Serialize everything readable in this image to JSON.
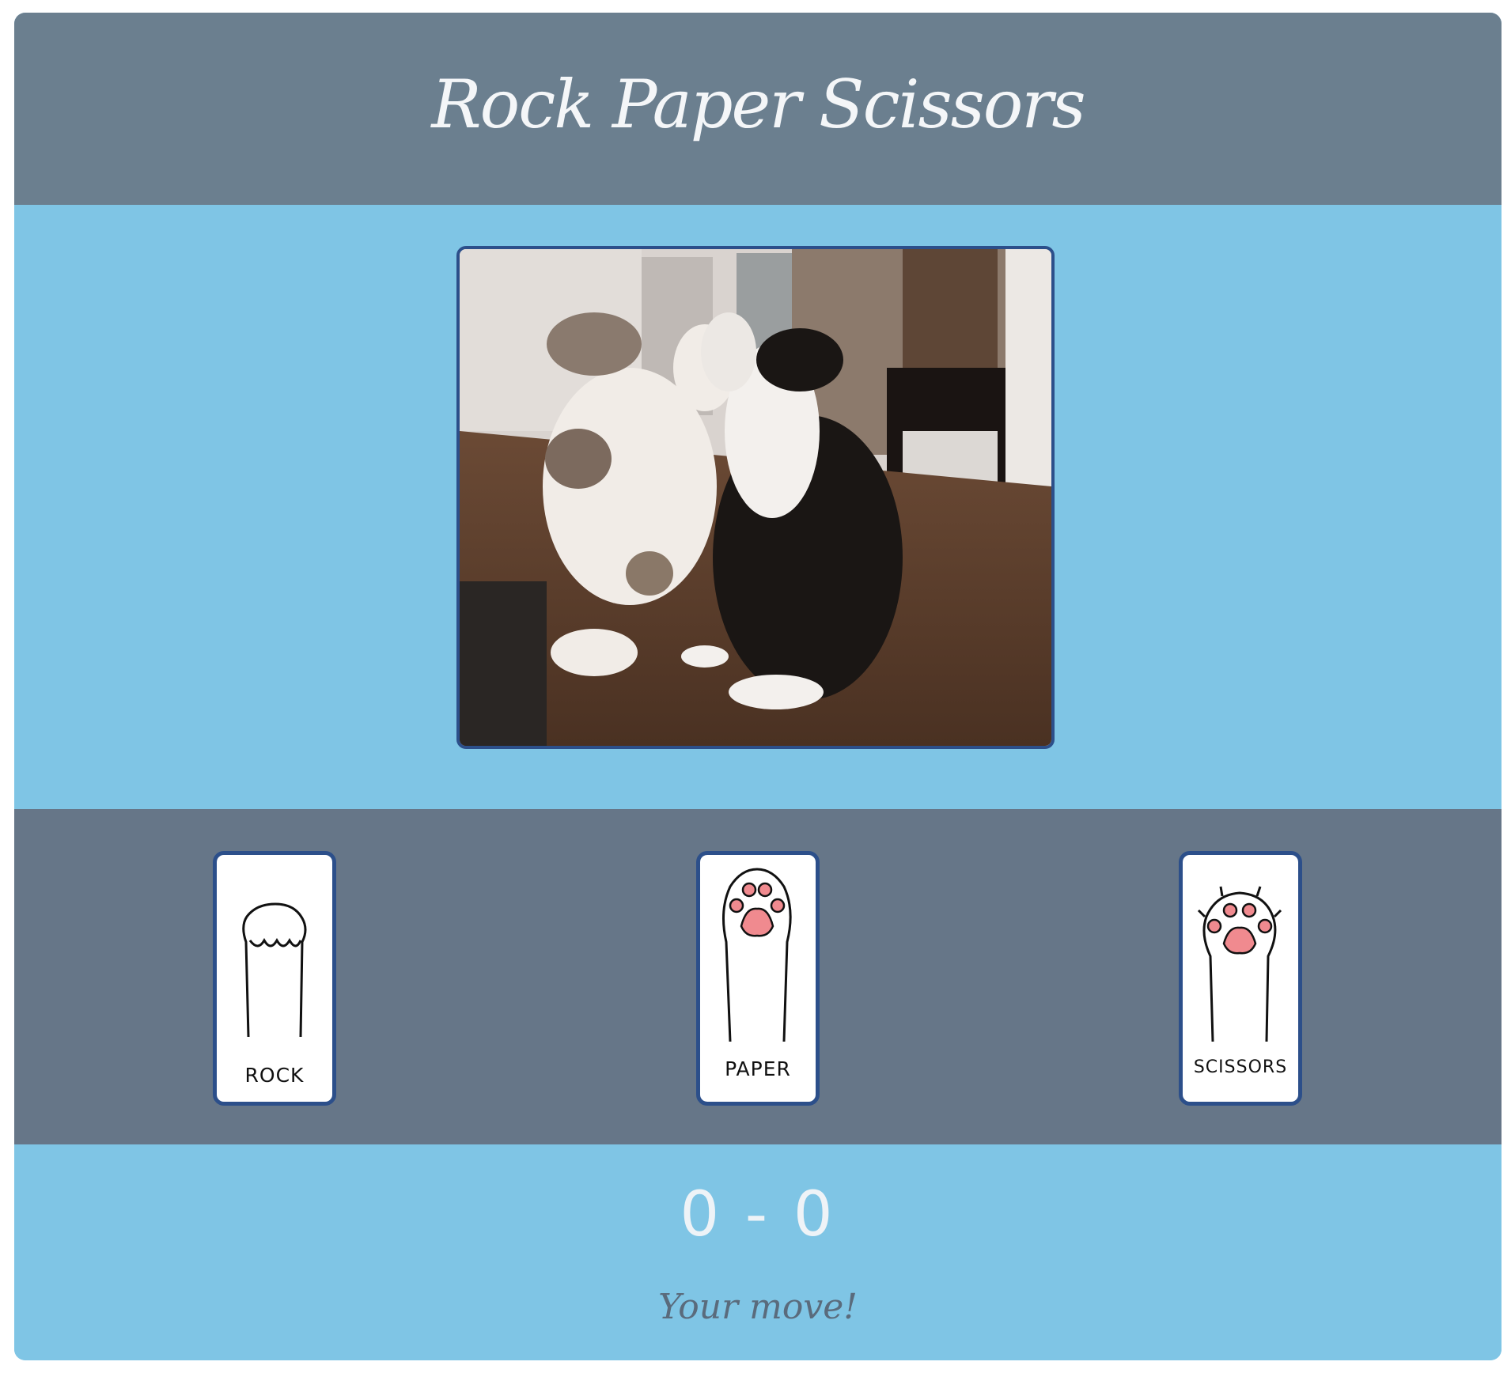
{
  "header": {
    "title": "Rock Paper Scissors"
  },
  "stage": {
    "image": "cats-boxing-gif"
  },
  "choices": [
    {
      "id": "rock",
      "label": "ROCK",
      "icon": "closed-paw-icon"
    },
    {
      "id": "paper",
      "label": "PAPER",
      "icon": "open-paw-icon"
    },
    {
      "id": "scissors",
      "label": "SCISSORS",
      "icon": "clawed-paw-icon"
    }
  ],
  "scoreboard": {
    "player": "0",
    "separator": "-",
    "computer": "0"
  },
  "status": "Your move!",
  "colors": {
    "header": "#6b7f8f",
    "stage": "#7fc5e5",
    "choices": "#667688",
    "card_border": "#2c4f8a",
    "paw_pad": "#f08a8f"
  }
}
